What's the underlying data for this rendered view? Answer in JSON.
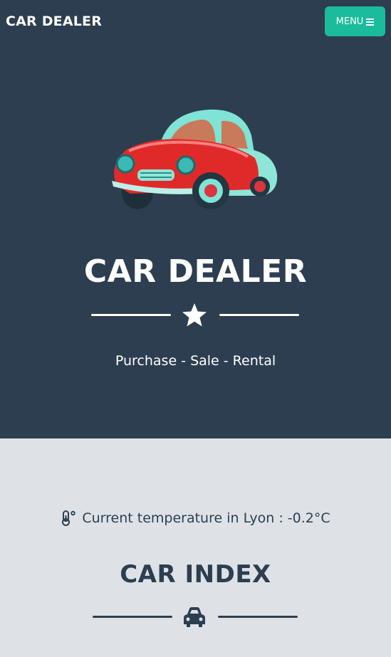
{
  "navbar": {
    "brand": "CAR DEALER",
    "menu_label": "MENU",
    "menu_icon": "hamburger-icon"
  },
  "hero": {
    "image": "red-cartoon-car",
    "title": "CAR DEALER",
    "divider_icon": "star-icon",
    "subtitle": "Purchase - Sale - Rental"
  },
  "weather": {
    "icon": "thermometer-icon",
    "text": "Current temperature in Lyon : -0.2°C"
  },
  "car_index": {
    "title": "CAR INDEX",
    "divider_icon": "car-icon"
  },
  "colors": {
    "primary": "#2c3e50",
    "accent": "#1abc9c",
    "light_bg": "#dee2e6",
    "white": "#ffffff"
  }
}
